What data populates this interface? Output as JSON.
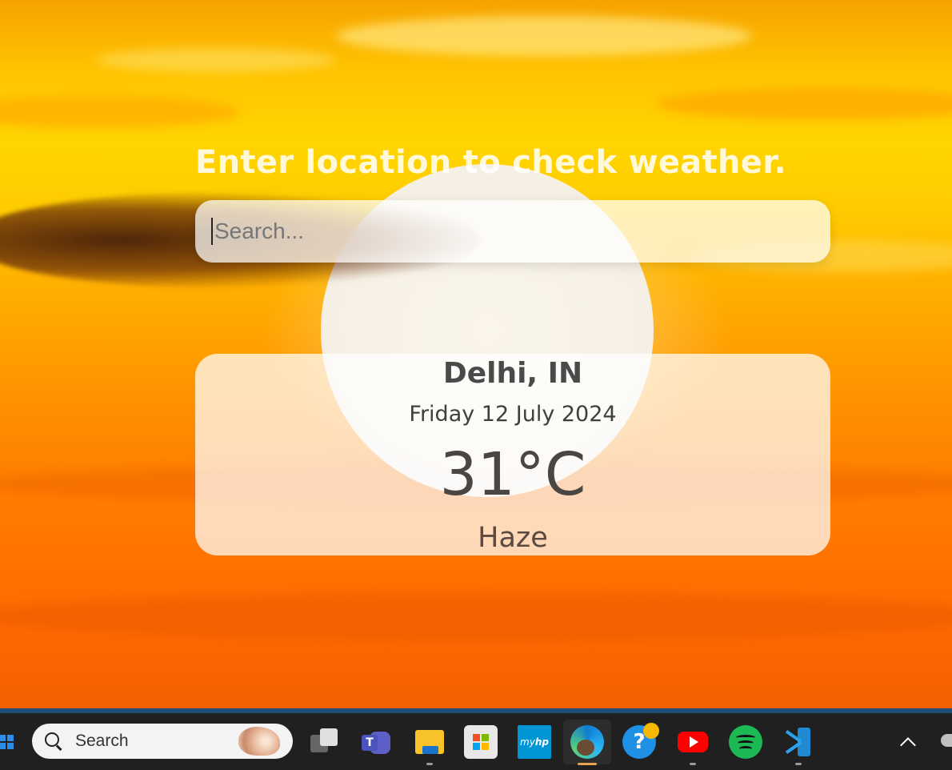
{
  "weather_app": {
    "heading": "Enter location to check weather.",
    "search": {
      "placeholder": "Search...",
      "value": ""
    },
    "result": {
      "location": "Delhi, IN",
      "date": "Friday 12 July 2024",
      "temperature": "31°C",
      "condition": "Haze"
    },
    "background": "sunset"
  },
  "taskbar": {
    "search_label": "Search",
    "apps": [
      {
        "name": "task-view",
        "icon": "task-view-icon",
        "running": false
      },
      {
        "name": "microsoft-teams",
        "icon": "teams-icon",
        "running": false
      },
      {
        "name": "file-explorer",
        "icon": "folder-icon",
        "running": true
      },
      {
        "name": "microsoft-store",
        "icon": "store-icon",
        "running": false
      },
      {
        "name": "myhp",
        "icon": "myhp-icon",
        "running": false
      },
      {
        "name": "microsoft-edge",
        "icon": "edge-icon",
        "running": true,
        "active": true
      },
      {
        "name": "get-help",
        "icon": "help-icon",
        "running": false
      },
      {
        "name": "youtube",
        "icon": "youtube-icon",
        "running": true
      },
      {
        "name": "spotify",
        "icon": "spotify-icon",
        "running": true
      },
      {
        "name": "visual-studio-code",
        "icon": "vscode-icon",
        "running": true
      }
    ],
    "colors": {
      "accent": "#1f4e79",
      "bar": "#202020",
      "active_indicator": "#e8a24d"
    }
  }
}
